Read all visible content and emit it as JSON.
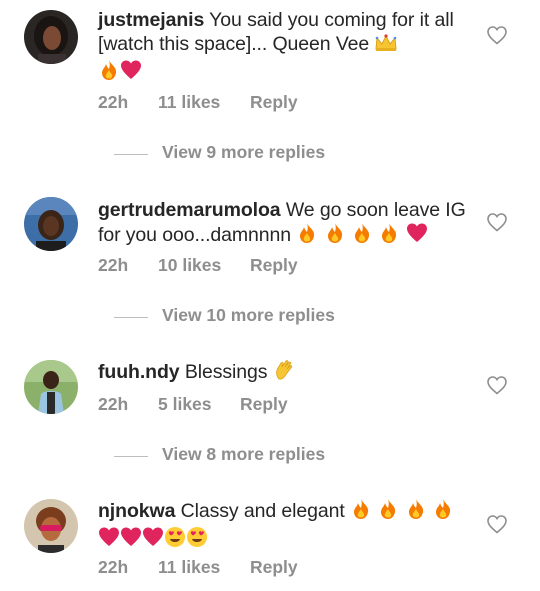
{
  "comments": [
    {
      "username": "justmejanis",
      "body": "You said you coming for it all [watch this space]... Queen Vee",
      "emoji_line": "",
      "time": "22h",
      "likes": "11 likes",
      "reply": "Reply",
      "view_replies": "View 9 more replies"
    },
    {
      "username": "gertrudemarumoloa",
      "body": "We go soon leave IG for you ooo...damnnnn",
      "time": "22h",
      "likes": "10 likes",
      "reply": "Reply",
      "view_replies": "View 10 more replies"
    },
    {
      "username": "fuuh.ndy",
      "body": "Blessings",
      "time": "22h",
      "likes": "5 likes",
      "reply": "Reply",
      "view_replies": "View 8 more replies"
    },
    {
      "username": "njnokwa",
      "body": "Classy and elegant",
      "time": "22h",
      "likes": "11 likes",
      "reply": "Reply"
    }
  ],
  "icons": {
    "like": "heart-outline-icon",
    "fire": "fire-emoji-icon",
    "red_heart": "red-heart-emoji-icon",
    "crown": "crown-emoji-icon",
    "clap": "clapping-hands-emoji-icon",
    "heart_eyes": "heart-eyes-emoji-icon"
  },
  "colors": {
    "text": "#262626",
    "secondary": "#8e8e8e",
    "divider": "#bdbdbd",
    "heart_red": "#e0245e",
    "fire_orange": "#f57c00"
  }
}
